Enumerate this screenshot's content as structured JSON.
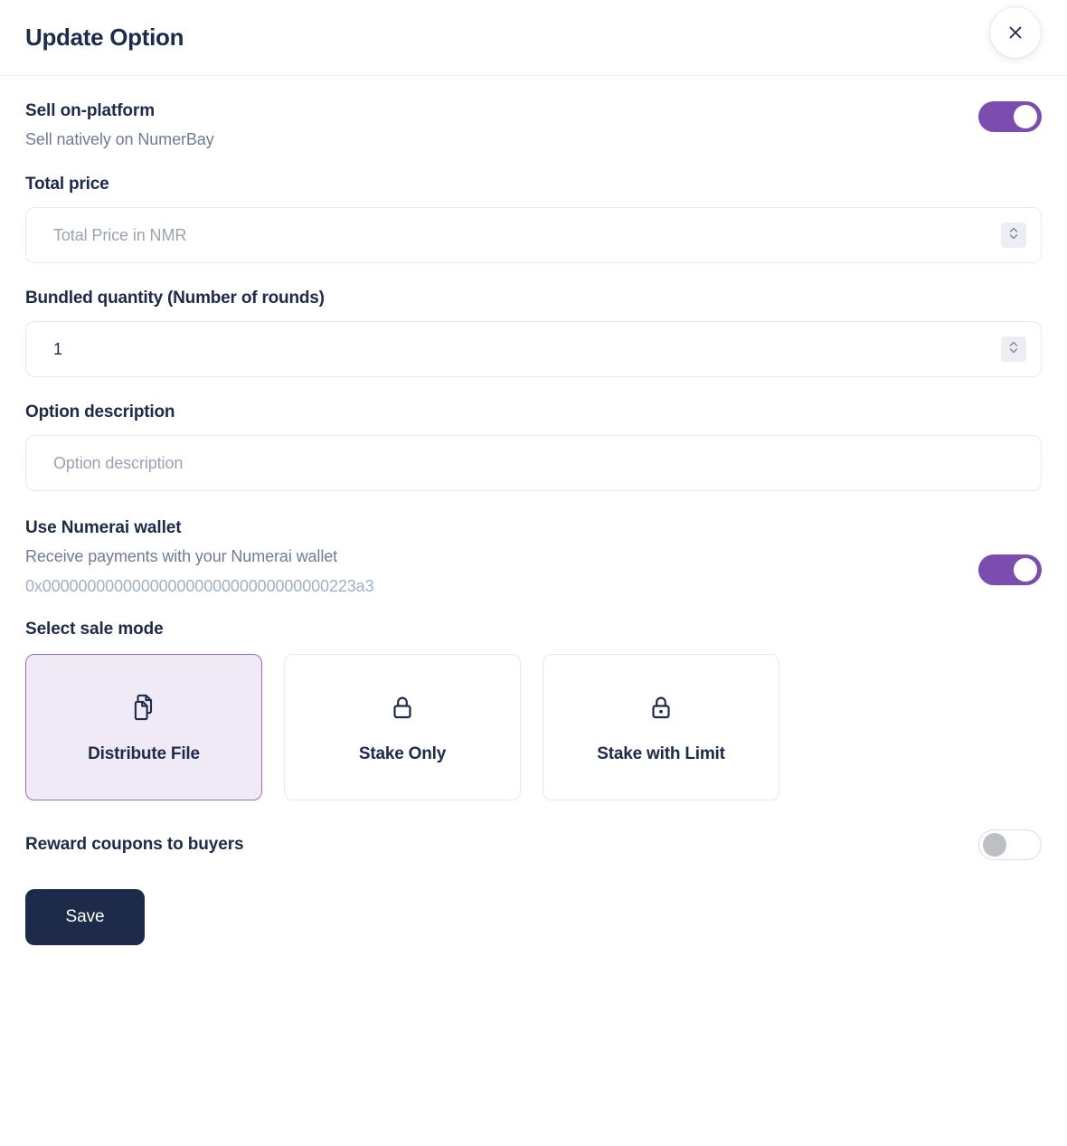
{
  "header": {
    "title": "Update Option",
    "close_icon": "close-icon"
  },
  "sell_on_platform": {
    "label": "Sell on-platform",
    "description": "Sell natively on NumerBay",
    "toggle_state": "on"
  },
  "total_price": {
    "label": "Total price",
    "placeholder": "Total Price in NMR",
    "value": "",
    "spinner_icon": "stepper-updown-icon"
  },
  "bundled_quantity": {
    "label": "Bundled quantity (Number of rounds)",
    "placeholder": "",
    "value": "1",
    "spinner_icon": "stepper-updown-icon"
  },
  "option_description": {
    "label": "Option description",
    "placeholder": "Option description",
    "value": ""
  },
  "numerai_wallet": {
    "label": "Use Numerai wallet",
    "description": "Receive payments with your Numerai wallet",
    "address": "0x00000000000000000000000000000000223a3",
    "toggle_state": "on"
  },
  "sale_mode": {
    "label": "Select sale mode",
    "selected": "Distribute File",
    "options": [
      {
        "label": "Distribute File",
        "icon": "documents-copy-icon",
        "selected": true
      },
      {
        "label": "Stake Only",
        "icon": "lock-icon",
        "selected": false
      },
      {
        "label": "Stake with Limit",
        "icon": "lock-keyhole-icon",
        "selected": false
      }
    ]
  },
  "reward_coupons": {
    "label": "Reward coupons to buyers",
    "toggle_state": "off"
  },
  "footer": {
    "save_label": "Save"
  },
  "colors": {
    "accent_purple": "#7c4daf",
    "selected_card_bg": "#f0eaf7",
    "selected_card_border": "#9a6bc4",
    "dark_navy": "#1e2a4a",
    "muted_text": "#717c91",
    "address_text": "#9fb0c9",
    "border": "#e7e9f0"
  }
}
